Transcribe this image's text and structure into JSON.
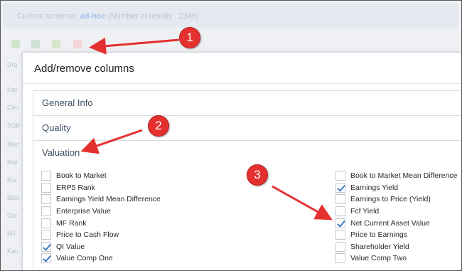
{
  "background": {
    "screener_prefix": "Current screener:",
    "screener_name": "ad-hoc",
    "results_text": "(Number of results : 2346)",
    "side_labels": [
      "Dra",
      "Nar",
      "Con",
      "TOP",
      "Mec",
      "Mar",
      "Kur",
      "Blos",
      "Glo",
      "MJ",
      "Kan"
    ]
  },
  "modal": {
    "title": "Add/remove columns",
    "sections": [
      {
        "label": "General Info"
      },
      {
        "label": "Quality"
      },
      {
        "label": "Valuation"
      }
    ],
    "left_items": [
      {
        "label": "Book to Market",
        "checked": false
      },
      {
        "label": "ERP5 Rank",
        "checked": false
      },
      {
        "label": "Earnings Yield Mean Difference",
        "checked": false
      },
      {
        "label": "Enterprise Value",
        "checked": false
      },
      {
        "label": "MF Rank",
        "checked": false
      },
      {
        "label": "Price to Cash Flow",
        "checked": false
      },
      {
        "label": "QI Value",
        "checked": true
      },
      {
        "label": "Value Comp One",
        "checked": true
      }
    ],
    "right_items": [
      {
        "label": "Book to Market Mean Difference",
        "checked": false
      },
      {
        "label": "Earnings Yield",
        "checked": true
      },
      {
        "label": "Earnings to Price (Yield)",
        "checked": false
      },
      {
        "label": "Fcf Yield",
        "checked": false
      },
      {
        "label": "Net Current Asset Value",
        "checked": true
      },
      {
        "label": "Price to Earnings",
        "checked": false
      },
      {
        "label": "Shareholder Yield",
        "checked": false
      },
      {
        "label": "Value Comp Two",
        "checked": false
      }
    ]
  },
  "callouts": [
    "1",
    "2",
    "3"
  ],
  "colors": {
    "callout": "#e53030",
    "check": "#3f7fc1"
  }
}
